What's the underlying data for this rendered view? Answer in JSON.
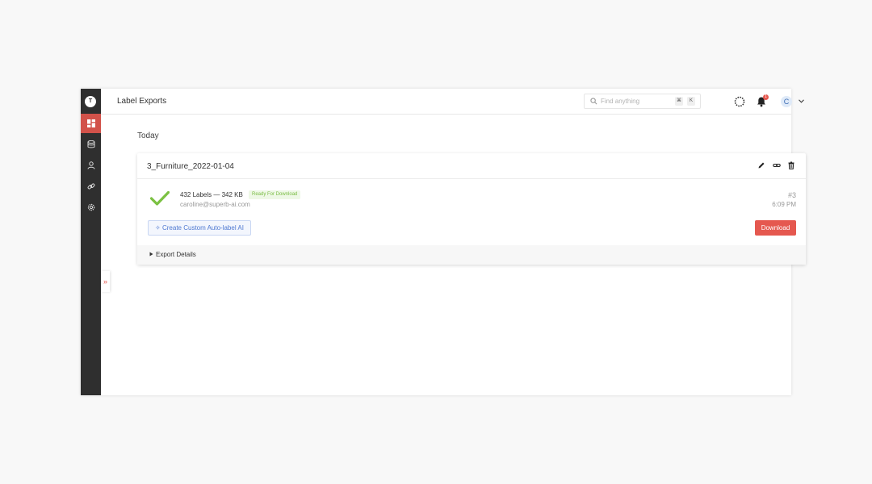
{
  "header": {
    "title": "Label Exports",
    "search_placeholder": "Find anything",
    "shortcut_cmd": "⌘",
    "shortcut_key": "K",
    "notification_count": "1",
    "user_initial": "C"
  },
  "sidebar": {
    "workspace_initial": "T",
    "items": [
      {
        "icon": "dashboard-icon",
        "active": true
      },
      {
        "icon": "database-icon",
        "active": false
      },
      {
        "icon": "user-icon",
        "active": false
      },
      {
        "icon": "link-icon",
        "active": false
      },
      {
        "icon": "gear-icon",
        "active": false
      }
    ],
    "expand_glyph": "»"
  },
  "main": {
    "section_label": "Today",
    "exports": [
      {
        "name": "3_Furniture_2022-01-04",
        "summary": "432 Labels — 342 KB",
        "status": "Ready For Download",
        "email": "caroline@superb-ai.com",
        "number": "#3",
        "time": "6:09 PM",
        "auto_label_button": "✧ Create Custom Auto-label AI",
        "download_button": "Download",
        "details_label": "Export Details"
      }
    ]
  },
  "colors": {
    "accent": "#e5584f",
    "sidebar_bg": "#2f2f2f",
    "success": "#7bc142",
    "link_blue": "#4e78d1"
  }
}
